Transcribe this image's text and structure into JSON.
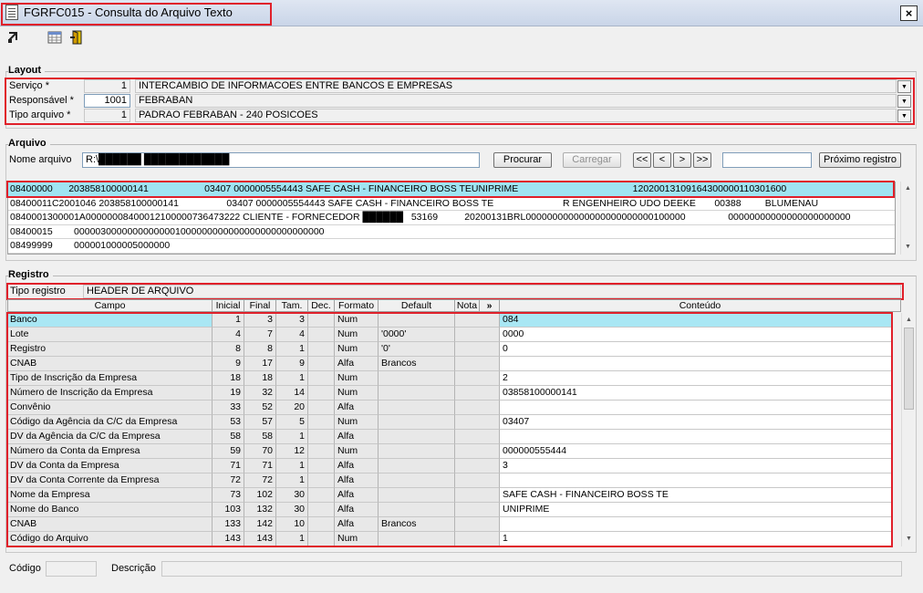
{
  "window": {
    "title": "FGRFC015 - Consulta do Arquivo Texto",
    "close_label": "×"
  },
  "toolbar": {
    "icons": [
      "export-icon",
      "grid-icon",
      "exit-door-icon"
    ]
  },
  "layout": {
    "title": "Layout",
    "servico": {
      "label": "Serviço *",
      "code": "1",
      "value": "INTERCAMBIO DE INFORMACOES ENTRE BANCOS E EMPRESAS"
    },
    "responsavel": {
      "label": "Responsável *",
      "code": "1001",
      "value": "FEBRABAN"
    },
    "tipo_arquivo": {
      "label": "Tipo arquivo *",
      "code": "1",
      "value": "PADRAO FEBRABAN - 240 POSICOES"
    }
  },
  "arquivo": {
    "title": "Arquivo",
    "nome_label": "Nome arquivo",
    "nome_value": "R:\\██████ ████████████",
    "procurar": "Procurar",
    "carregar": "Carregar",
    "nav": [
      "<<",
      "<",
      ">",
      ">>"
    ],
    "search_value": "",
    "proximo": "Próximo registro",
    "lines": [
      "08400000      203858100000141                     03407 0000005554443 SAFE CASH - FINANCEIRO BOSS TEUNIPRIME                                           12020013109164300000110301600",
      "08400011C2001046 203858100000141                  03407 0000005554443 SAFE CASH - FINANCEIRO BOSS TE                          R ENGENHEIRO UDO DEEKE       00388         BLUMENAU",
      "0840001300001A00000008400012100000736473222 CLIENTE - FORNECEDOR ██████   53169          20200131BRL000000000000000000000000100000                00000000000000000000000",
      "08400015        00000300000000000001000000000000000000000000000",
      "08499999        000001000005000000"
    ]
  },
  "registro": {
    "title": "Registro",
    "tipo_label": "Tipo registro",
    "tipo_value": "HEADER DE ARQUIVO",
    "columns": [
      "Campo",
      "Inicial",
      "Final",
      "Tam.",
      "Dec.",
      "Formato",
      "Default",
      "Nota",
      "»",
      "Conteúdo"
    ],
    "rows": [
      [
        "Banco",
        "1",
        "3",
        "3",
        "",
        "Num",
        "",
        "",
        "084"
      ],
      [
        "Lote",
        "4",
        "7",
        "4",
        "",
        "Num",
        "'0000'",
        "",
        "0000"
      ],
      [
        "Registro",
        "8",
        "8",
        "1",
        "",
        "Num",
        "'0'",
        "",
        "0"
      ],
      [
        "CNAB",
        "9",
        "17",
        "9",
        "",
        "Alfa",
        "Brancos",
        "",
        ""
      ],
      [
        "Tipo de Inscrição da Empresa",
        "18",
        "18",
        "1",
        "",
        "Num",
        "",
        "",
        "2"
      ],
      [
        "Número de Inscrição da Empresa",
        "19",
        "32",
        "14",
        "",
        "Num",
        "",
        "",
        "03858100000141"
      ],
      [
        "Convênio",
        "33",
        "52",
        "20",
        "",
        "Alfa",
        "",
        "",
        ""
      ],
      [
        "Código da Agência da C/C da Empresa",
        "53",
        "57",
        "5",
        "",
        "Num",
        "",
        "",
        "03407"
      ],
      [
        "DV da Agência da C/C da Empresa",
        "58",
        "58",
        "1",
        "",
        "Alfa",
        "",
        "",
        ""
      ],
      [
        "Número da Conta da Empresa",
        "59",
        "70",
        "12",
        "",
        "Num",
        "",
        "",
        "000000555444"
      ],
      [
        "DV da Conta da Empresa",
        "71",
        "71",
        "1",
        "",
        "Alfa",
        "",
        "",
        "3"
      ],
      [
        "DV da Conta Corrente da Empresa",
        "72",
        "72",
        "1",
        "",
        "Alfa",
        "",
        "",
        ""
      ],
      [
        "Nome da Empresa",
        "73",
        "102",
        "30",
        "",
        "Alfa",
        "",
        "",
        "SAFE CASH - FINANCEIRO BOSS TE"
      ],
      [
        "Nome do Banco",
        "103",
        "132",
        "30",
        "",
        "Alfa",
        "",
        "",
        "UNIPRIME"
      ],
      [
        "CNAB",
        "133",
        "142",
        "10",
        "",
        "Alfa",
        "Brancos",
        "",
        ""
      ],
      [
        "Código do Arquivo",
        "143",
        "143",
        "1",
        "",
        "Num",
        "",
        "",
        "1"
      ]
    ]
  },
  "footer": {
    "codigo_label": "Código",
    "codigo_value": "",
    "descricao_label": "Descrição",
    "descricao_value": ""
  }
}
